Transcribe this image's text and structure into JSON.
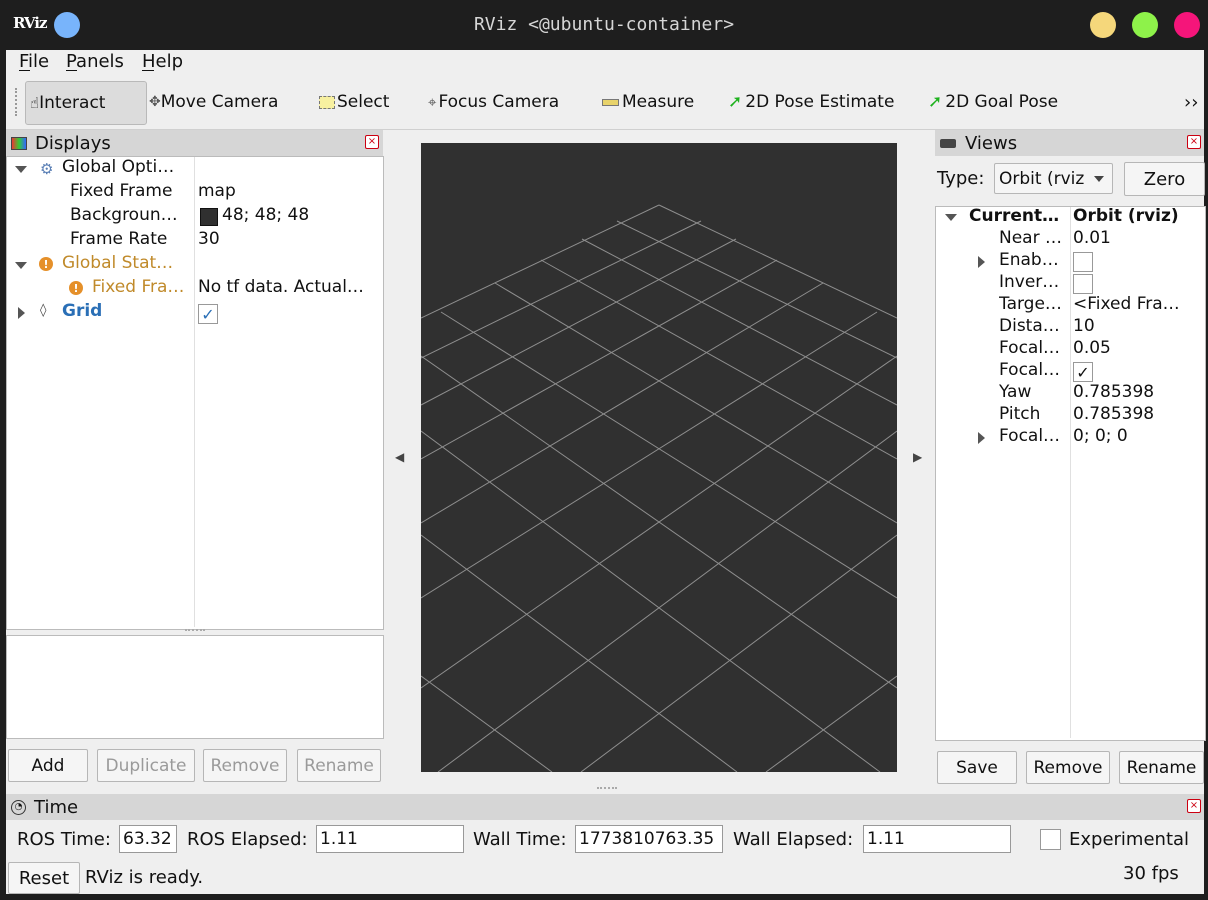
{
  "window": {
    "logo_text": "RViz",
    "title": "RViz <@ubuntu-container>",
    "colors": {
      "titlebar": "#1e1e1e",
      "minimize": "#f5d77b",
      "maximize": "#8ef24a",
      "close": "#f5157a",
      "app_dot": "#78b4fb"
    }
  },
  "menu": {
    "file": "File",
    "panels": "Panels",
    "help": "Help"
  },
  "toolbar": {
    "interact": "Interact",
    "move_camera": "Move Camera",
    "select": "Select",
    "focus_camera": "Focus Camera",
    "measure": "Measure",
    "pose_estimate": "2D Pose Estimate",
    "goal_pose": "2D Goal Pose",
    "overflow": "››"
  },
  "displays": {
    "title": "Displays",
    "rows": [
      {
        "label": "Global Opti…",
        "value": ""
      },
      {
        "label": "Fixed Frame",
        "value": "map"
      },
      {
        "label": "Backgroun…",
        "value": "48; 48; 48"
      },
      {
        "label": "Frame Rate",
        "value": "30"
      },
      {
        "label": "Global Stat…",
        "value": ""
      },
      {
        "label": "Fixed Fra…",
        "value": "No tf data.  Actual…"
      },
      {
        "label": "Grid",
        "value": ""
      }
    ],
    "buttons": {
      "add": "Add",
      "duplicate": "Duplicate",
      "remove": "Remove",
      "rename": "Rename"
    },
    "background_color": "#303030",
    "warning_color": "#c08a2a",
    "grid_color": "#2a6fb6"
  },
  "viewport": {
    "background_color": "#303030",
    "grid_line_color": "#a0a0a0"
  },
  "views": {
    "title": "Views",
    "type_label": "Type:",
    "type_value": "Orbit (rviz",
    "zero": "Zero",
    "rows": [
      {
        "label": "Current…",
        "value": "Orbit (rviz)"
      },
      {
        "label": "Near …",
        "value": "0.01"
      },
      {
        "label": "Enab…",
        "value": ""
      },
      {
        "label": "Inver…",
        "value": ""
      },
      {
        "label": "Targe…",
        "value": "<Fixed Fra…"
      },
      {
        "label": "Dista…",
        "value": "10"
      },
      {
        "label": "Focal…",
        "value": "0.05"
      },
      {
        "label": "Focal…",
        "value": ""
      },
      {
        "label": "Yaw",
        "value": "0.785398"
      },
      {
        "label": "Pitch",
        "value": "0.785398"
      },
      {
        "label": "Focal…",
        "value": "0; 0; 0"
      }
    ],
    "buttons": {
      "save": "Save",
      "remove": "Remove",
      "rename": "Rename"
    }
  },
  "time": {
    "title": "Time",
    "ros_time_label": "ROS Time:",
    "ros_time": "63.32",
    "ros_elapsed_label": "ROS Elapsed:",
    "ros_elapsed": "1.11",
    "wall_time_label": "Wall Time:",
    "wall_time": "1773810763.35",
    "wall_elapsed_label": "Wall Elapsed:",
    "wall_elapsed": "1.11",
    "experimental": "Experimental",
    "reset": "Reset",
    "status": "RViz is ready.",
    "fps": "30 fps"
  }
}
